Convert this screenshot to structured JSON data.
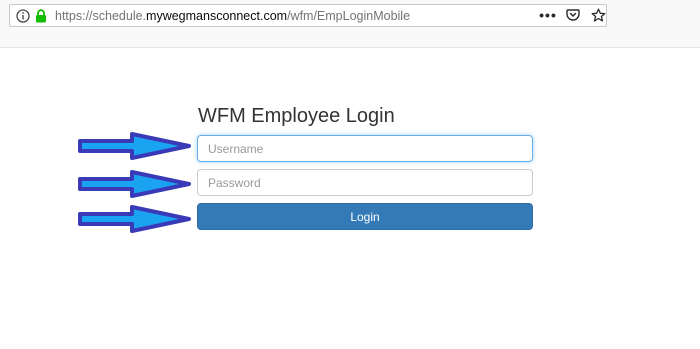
{
  "browser": {
    "url_prefix": "https://schedule.",
    "url_domain": "mywegmansconnect.com",
    "url_path": "/wfm/EmpLoginMobile",
    "icons": [
      "info-icon",
      "lock-icon",
      "more-actions-icon",
      "pocket-icon",
      "bookmark-star-icon"
    ]
  },
  "login": {
    "title": "WFM Employee Login",
    "username_placeholder": "Username",
    "password_placeholder": "Password",
    "login_label": "Login"
  },
  "colors": {
    "button": "#337ab7",
    "arrow_fill": "#1aa3f0",
    "arrow_stroke": "#3a3ab8",
    "lock": "#12bc00"
  }
}
